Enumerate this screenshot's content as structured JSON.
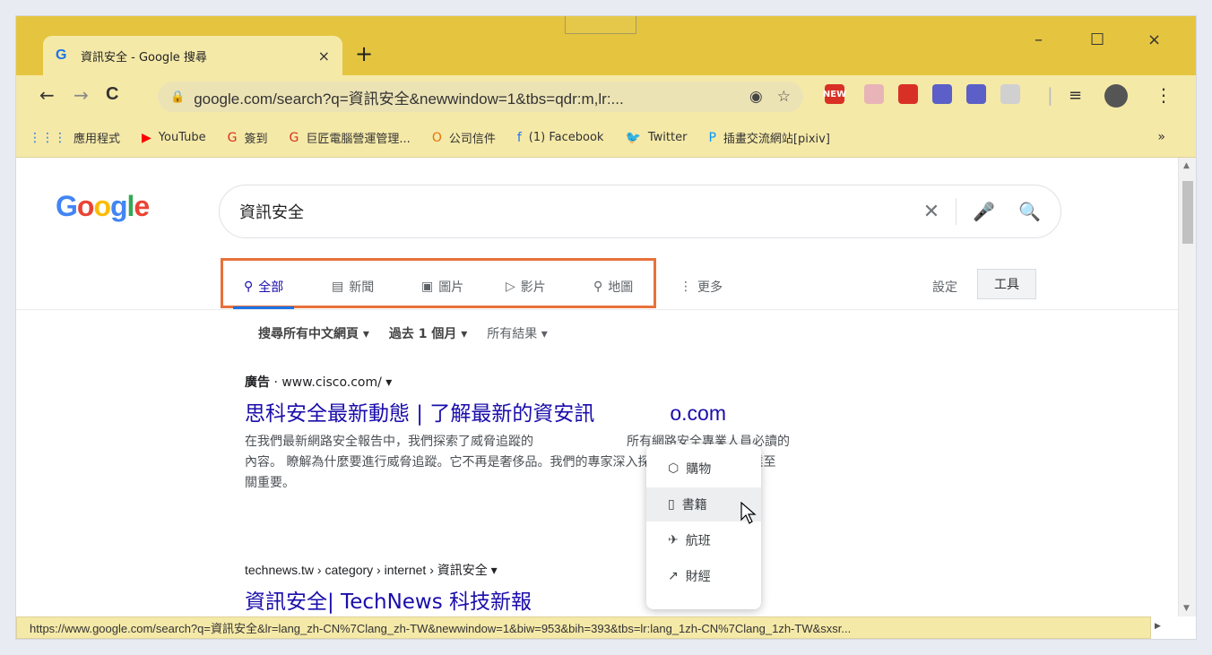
{
  "browser": {
    "tab": {
      "favicon": "G",
      "title": "資訊安全 - Google 搜尋",
      "close": "×"
    },
    "new_tab": "+",
    "window_controls": {
      "minimize": "–",
      "maximize": "☐",
      "close": "×"
    },
    "nav": {
      "back": "←",
      "forward": "→",
      "reload": "C"
    },
    "address": {
      "url": "google.com/search?q=資訊安全&newwindow=1&tbs=qdr:m,lr:..."
    },
    "extensions": [
      {
        "name": "new-badge-extension",
        "label": "NEW",
        "color": "#d93025"
      },
      {
        "name": "ticket-extension",
        "label": "",
        "color": "#e8b4b8"
      },
      {
        "name": "pdf-extension",
        "label": "",
        "color": "#d93025"
      },
      {
        "name": "grid-extension",
        "label": "",
        "color": "#5b5fc7"
      },
      {
        "name": "chat-extension",
        "label": "",
        "color": "#5b5fc7"
      },
      {
        "name": "line-extension",
        "label": "",
        "color": "#d0d0d0"
      }
    ],
    "bookmarks": [
      {
        "icon": "apps-icon",
        "glyph": "⋮⋮⋮",
        "color": "#1a73e8",
        "label": "應用程式"
      },
      {
        "icon": "youtube-icon",
        "glyph": "▶",
        "color": "#ff0000",
        "label": "YouTube"
      },
      {
        "icon": "signin-icon",
        "glyph": "G",
        "color": "#d93025",
        "label": "簽到"
      },
      {
        "icon": "manager-icon",
        "glyph": "G",
        "color": "#d93025",
        "label": "巨匠電腦營運管理..."
      },
      {
        "icon": "office-icon",
        "glyph": "O",
        "color": "#e8710a",
        "label": "公司信件"
      },
      {
        "icon": "facebook-icon",
        "glyph": "f",
        "color": "#1877f2",
        "label": "(1) Facebook"
      },
      {
        "icon": "twitter-icon",
        "glyph": "🐦",
        "color": "#1da1f2",
        "label": "Twitter"
      },
      {
        "icon": "pixiv-icon",
        "glyph": "P",
        "color": "#0096fa",
        "label": "插畫交流網站[pixiv]"
      }
    ],
    "bookmarks_more": "»",
    "status_url": "https://www.google.com/search?q=資訊安全&lr=lang_zh-CN%7Clang_zh-TW&newwindow=1&biw=953&bih=393&tbs=lr:lang_1zh-CN%7Clang_1zh-TW&sxsr..."
  },
  "google": {
    "logo": [
      {
        "ch": "G",
        "color": "#4285f4"
      },
      {
        "ch": "o",
        "color": "#ea4335"
      },
      {
        "ch": "o",
        "color": "#fbbc05"
      },
      {
        "ch": "g",
        "color": "#4285f4"
      },
      {
        "ch": "l",
        "color": "#34a853"
      },
      {
        "ch": "e",
        "color": "#ea4335"
      }
    ],
    "query": "資訊安全",
    "tabs": [
      {
        "icon": "⚲",
        "label": "全部"
      },
      {
        "icon": "▤",
        "label": "新聞"
      },
      {
        "icon": "▣",
        "label": "圖片"
      },
      {
        "icon": "▷",
        "label": "影片"
      },
      {
        "icon": "⚲",
        "label": "地圖"
      },
      {
        "icon": "⋮",
        "label": "更多"
      }
    ],
    "settings": "設定",
    "tools": "工具",
    "filters": [
      {
        "label": "搜尋所有中文網頁 ▾",
        "bold": true
      },
      {
        "label": "過去 1 個月 ▾",
        "bold": true
      },
      {
        "label": "所有結果 ▾",
        "bold": false
      }
    ],
    "more_menu": [
      {
        "icon": "⬡",
        "label": "購物"
      },
      {
        "icon": "▯",
        "label": "書籍"
      },
      {
        "icon": "✈",
        "label": "航班"
      },
      {
        "icon": "↗",
        "label": "財經"
      }
    ],
    "results": {
      "ad": {
        "badge": "廣告",
        "url": " · www.cisco.com/ ▾",
        "title": "思科安全最新動態 | 了解最新的資安訊",
        "title_tail": "o.com",
        "desc1": "在我們最新網路安全報告中，我們探索了威脅追蹤的",
        "desc1_tail": "所有網路安全專業人員必讀的",
        "desc2": "內容。 瞭解為什麼要進行威脅追蹤。它不再是奢侈品。我們的專家深入探討了為什麼它對企業至",
        "desc3": "關重要。"
      },
      "second": {
        "cite": "technews.tw › category › internet › 資訊安全 ▾",
        "title": "資訊安全| TechNews 科技新報"
      }
    }
  }
}
